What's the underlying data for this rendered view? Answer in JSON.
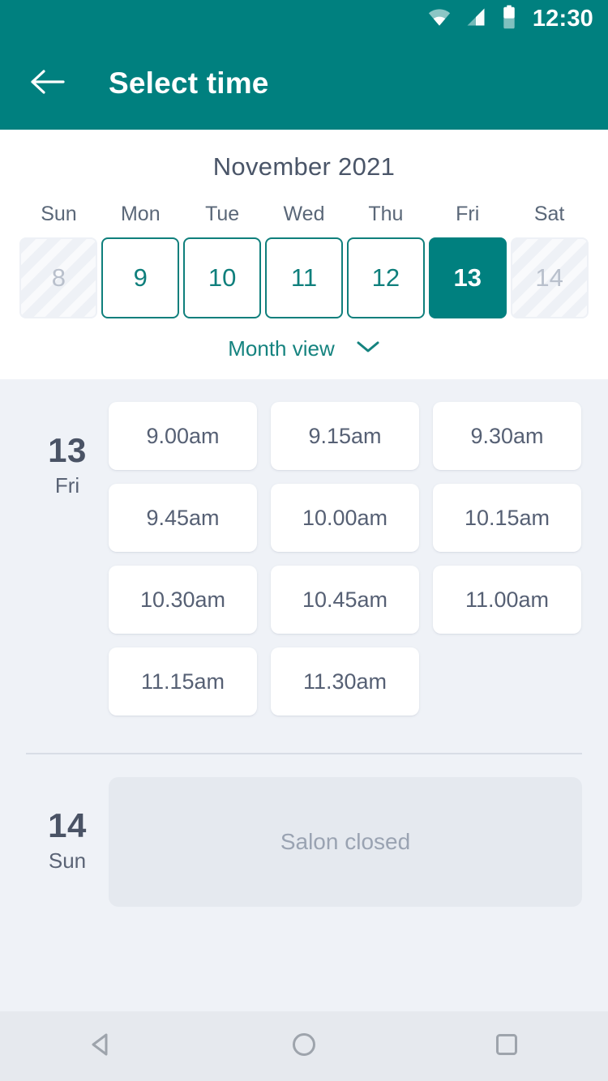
{
  "status_bar": {
    "time": "12:30",
    "icons": [
      "wifi-icon",
      "signal-icon",
      "battery-icon"
    ]
  },
  "app_bar": {
    "back_icon": "back-arrow-icon",
    "title": "Select time"
  },
  "calendar": {
    "month_label": "November 2021",
    "weekdays": [
      "Sun",
      "Mon",
      "Tue",
      "Wed",
      "Thu",
      "Fri",
      "Sat"
    ],
    "dates": [
      {
        "day": "8",
        "state": "disabled"
      },
      {
        "day": "9",
        "state": "enabled"
      },
      {
        "day": "10",
        "state": "enabled"
      },
      {
        "day": "11",
        "state": "enabled"
      },
      {
        "day": "12",
        "state": "enabled"
      },
      {
        "day": "13",
        "state": "selected"
      },
      {
        "day": "14",
        "state": "disabled"
      }
    ],
    "month_view": {
      "label": "Month view",
      "icon": "chevron-down-icon"
    }
  },
  "day_groups": [
    {
      "day_number": "13",
      "day_of_week": "Fri",
      "slots": [
        "9.00am",
        "9.15am",
        "9.30am",
        "9.45am",
        "10.00am",
        "10.15am",
        "10.30am",
        "10.45am",
        "11.00am",
        "11.15am",
        "11.30am"
      ]
    },
    {
      "day_number": "14",
      "day_of_week": "Sun",
      "closed_message": "Salon closed"
    }
  ],
  "nav_bar": {
    "back": "nav-back-icon",
    "home": "nav-home-icon",
    "recents": "nav-recents-icon"
  },
  "colors": {
    "primary_teal": "#00807f",
    "accent_teal": "#0f7f7c",
    "page_bg": "#eff2f7",
    "card_bg": "#ffffff",
    "text_dark": "#4a5365",
    "text_muted": "#9aa3b2",
    "disabled_bg": "#eef1f6",
    "closed_bg": "#e5e9ef",
    "nav_bg": "#e6e9ee"
  }
}
